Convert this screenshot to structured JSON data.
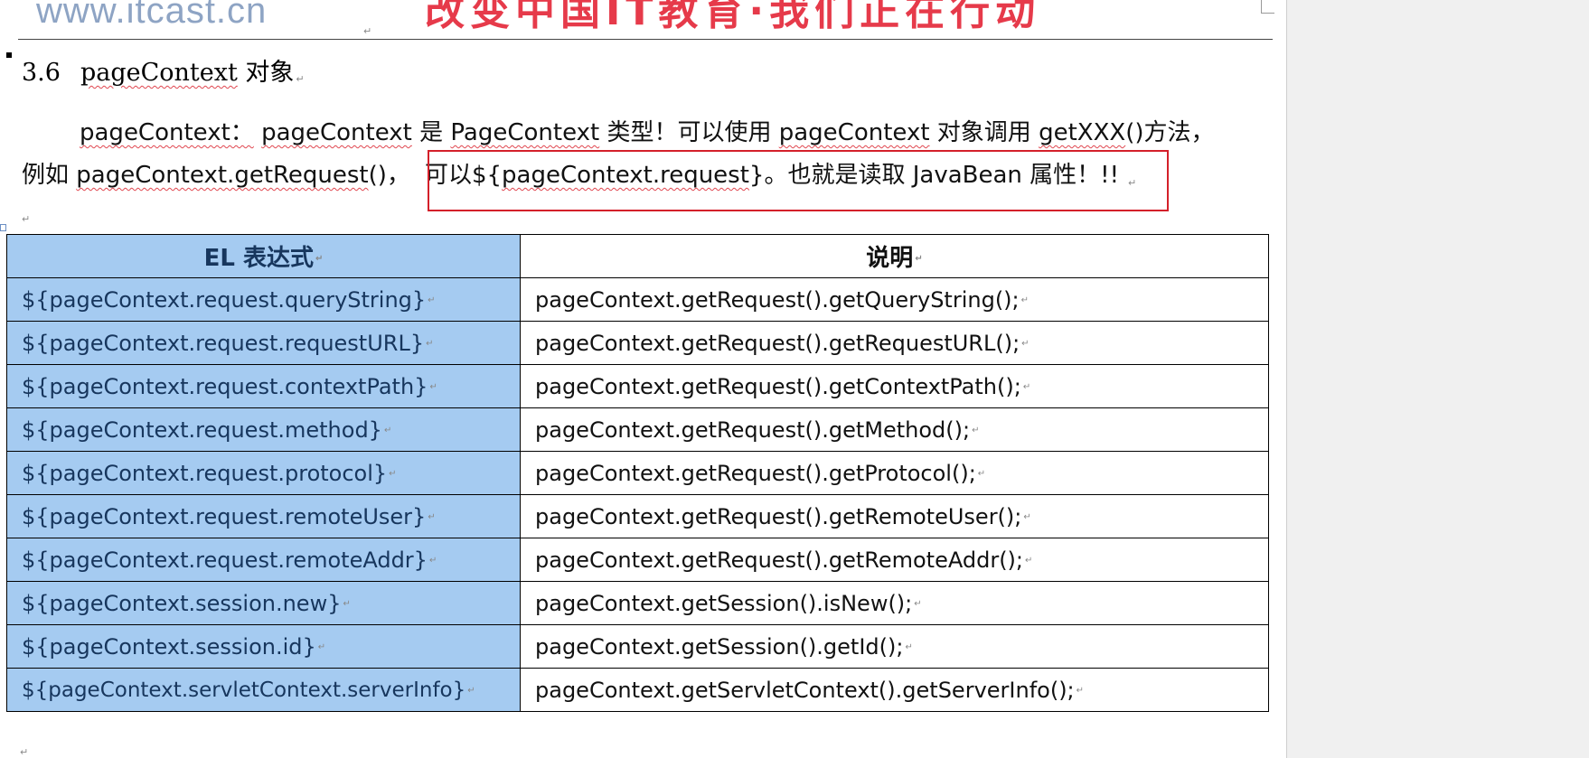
{
  "header": {
    "logo_text": "www.itcast.cn",
    "banner_text": "改变中国IT教育·我们正在行动"
  },
  "section": {
    "number": "3.6",
    "title_code": "pageContext",
    "title_suffix": "对象"
  },
  "paragraph": {
    "line1": {
      "t1": "pageContext：",
      "t2": "pageContext",
      "t3": " 是 ",
      "t4": "PageContext",
      "t5": " 类型！可以使用 ",
      "t6": "pageContext",
      "t7": " 对象调用 ",
      "t8": "getXXX",
      "t9": "()方法，"
    },
    "line2": {
      "t1": "例如 ",
      "t2": "pageContext.getRequest",
      "t3": "()，",
      "t4": "可以${",
      "t5": "pageContext.request",
      "t6": "}。也就是读取 JavaBean 属性！!!"
    }
  },
  "table": {
    "headers": {
      "expr": "EL 表达式",
      "desc": "说明"
    },
    "rows": [
      {
        "expr": "${pageContext.request.queryString}",
        "desc": "pageContext.getRequest().getQueryString();"
      },
      {
        "expr": "${pageContext.request.requestURL}",
        "desc": "pageContext.getRequest().getRequestURL();"
      },
      {
        "expr": "${pageContext.request.contextPath}",
        "desc": "pageContext.getRequest().getContextPath();"
      },
      {
        "expr": "${pageContext.request.method}",
        "desc": "pageContext.getRequest().getMethod();"
      },
      {
        "expr": "${pageContext.request.protocol}",
        "desc": "pageContext.getRequest().getProtocol();"
      },
      {
        "expr": "${pageContext.request.remoteUser}",
        "desc": "pageContext.getRequest().getRemoteUser();"
      },
      {
        "expr": "${pageContext.request.remoteAddr}",
        "desc": "pageContext.getRequest().getRemoteAddr();"
      },
      {
        "expr": "${pageContext.session.new}",
        "desc": "pageContext.getSession().isNew();"
      },
      {
        "expr": "${pageContext.session.id}",
        "desc": "pageContext.getSession().getId();"
      },
      {
        "expr": "${pageContext.servletContext.serverInfo}",
        "desc": "pageContext.getServletContext().getServerInfo();"
      }
    ]
  },
  "marks": {
    "paragraph": "↵"
  }
}
